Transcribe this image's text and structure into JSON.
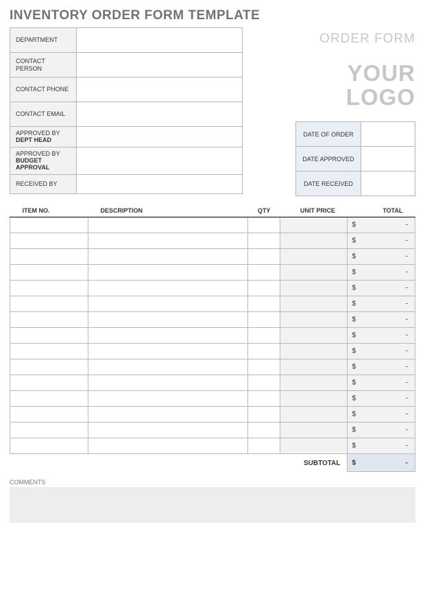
{
  "title": "INVENTORY ORDER FORM TEMPLATE",
  "header": {
    "order_form": "ORDER FORM",
    "logo_line1": "YOUR",
    "logo_line2": "LOGO"
  },
  "info": [
    {
      "label": "DEPARTMENT",
      "value": ""
    },
    {
      "label": "CONTACT PERSON",
      "value": ""
    },
    {
      "label": "CONTACT PHONE",
      "value": ""
    },
    {
      "label": "CONTACT EMAIL",
      "value": ""
    },
    {
      "label": "APPROVED BY",
      "sub": "DEPT HEAD",
      "value": ""
    },
    {
      "label": "APPROVED BY",
      "sub": "BUDGET APPROVAL",
      "value": ""
    },
    {
      "label": "RECEIVED BY",
      "value": ""
    }
  ],
  "dates": [
    {
      "label": "DATE OF ORDER",
      "value": ""
    },
    {
      "label": "DATE APPROVED",
      "value": ""
    },
    {
      "label": "DATE RECEIVED",
      "value": ""
    }
  ],
  "columns": {
    "item": "ITEM NO.",
    "desc": "DESCRIPTION",
    "qty": "QTY",
    "unit": "UNIT PRICE",
    "total": "TOTAL"
  },
  "currency": "$",
  "dash": "-",
  "rows": 15,
  "subtotal_label": "SUBTOTAL",
  "comments_label": "COMMENTS"
}
